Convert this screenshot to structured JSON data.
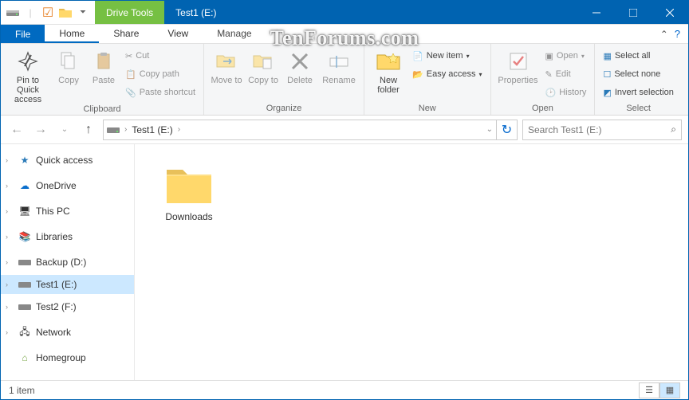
{
  "window": {
    "title": "Test1 (E:)",
    "drive_tools_label": "Drive Tools",
    "watermark": "TenForums.com"
  },
  "tabs": {
    "file": "File",
    "home": "Home",
    "share": "Share",
    "view": "View",
    "manage": "Manage"
  },
  "ribbon": {
    "clipboard": {
      "label": "Clipboard",
      "pin": "Pin to Quick access",
      "copy": "Copy",
      "paste": "Paste",
      "cut": "Cut",
      "copy_path": "Copy path",
      "paste_shortcut": "Paste shortcut"
    },
    "organize": {
      "label": "Organize",
      "move_to": "Move to",
      "copy_to": "Copy to",
      "delete": "Delete",
      "rename": "Rename"
    },
    "new": {
      "label": "New",
      "new_folder": "New folder",
      "new_item": "New item",
      "easy_access": "Easy access"
    },
    "open": {
      "label": "Open",
      "properties": "Properties",
      "open": "Open",
      "edit": "Edit",
      "history": "History"
    },
    "select": {
      "label": "Select",
      "select_all": "Select all",
      "select_none": "Select none",
      "invert": "Invert selection"
    }
  },
  "address": {
    "crumb": "Test1 (E:)",
    "search_placeholder": "Search Test1 (E:)"
  },
  "nav": {
    "quick_access": "Quick access",
    "onedrive": "OneDrive",
    "this_pc": "This PC",
    "libraries": "Libraries",
    "backup": "Backup (D:)",
    "test1": "Test1 (E:)",
    "test2": "Test2 (F:)",
    "network": "Network",
    "homegroup": "Homegroup"
  },
  "files": {
    "item0": "Downloads"
  },
  "status": {
    "count": "1 item"
  }
}
